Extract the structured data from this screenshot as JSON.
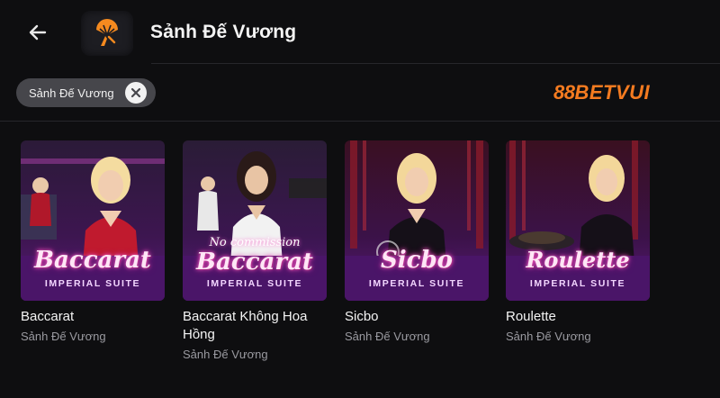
{
  "header": {
    "title": "Sảnh Đế Vương",
    "back_icon": "arrow-left-icon",
    "lobby_icon": "fan-lobby-icon"
  },
  "filter": {
    "chip_label": "Sảnh Đế Vương",
    "chip_close_icon": "close-icon"
  },
  "brand": {
    "number": "88",
    "text": "BETVUI",
    "color": "#f47b20"
  },
  "games": [
    {
      "thumb_title": "Baccarat",
      "thumb_subtitle": "",
      "thumb_suite": "IMPERIAL SUITE",
      "name": "Baccarat",
      "lobby": "Sảnh Đế Vương"
    },
    {
      "thumb_title": "Baccarat",
      "thumb_subtitle": "No commission",
      "thumb_suite": "IMPERIAL SUITE",
      "name": "Baccarat Không Hoa Hồng",
      "lobby": "Sảnh Đế Vương"
    },
    {
      "thumb_title": "Sicbo",
      "thumb_subtitle": "",
      "thumb_suite": "IMPERIAL SUITE",
      "name": "Sicbo",
      "lobby": "Sảnh Đế Vương"
    },
    {
      "thumb_title": "Roulette",
      "thumb_subtitle": "",
      "thumb_suite": "IMPERIAL SUITE",
      "name": "Roulette",
      "lobby": "Sảnh Đế Vương"
    }
  ]
}
